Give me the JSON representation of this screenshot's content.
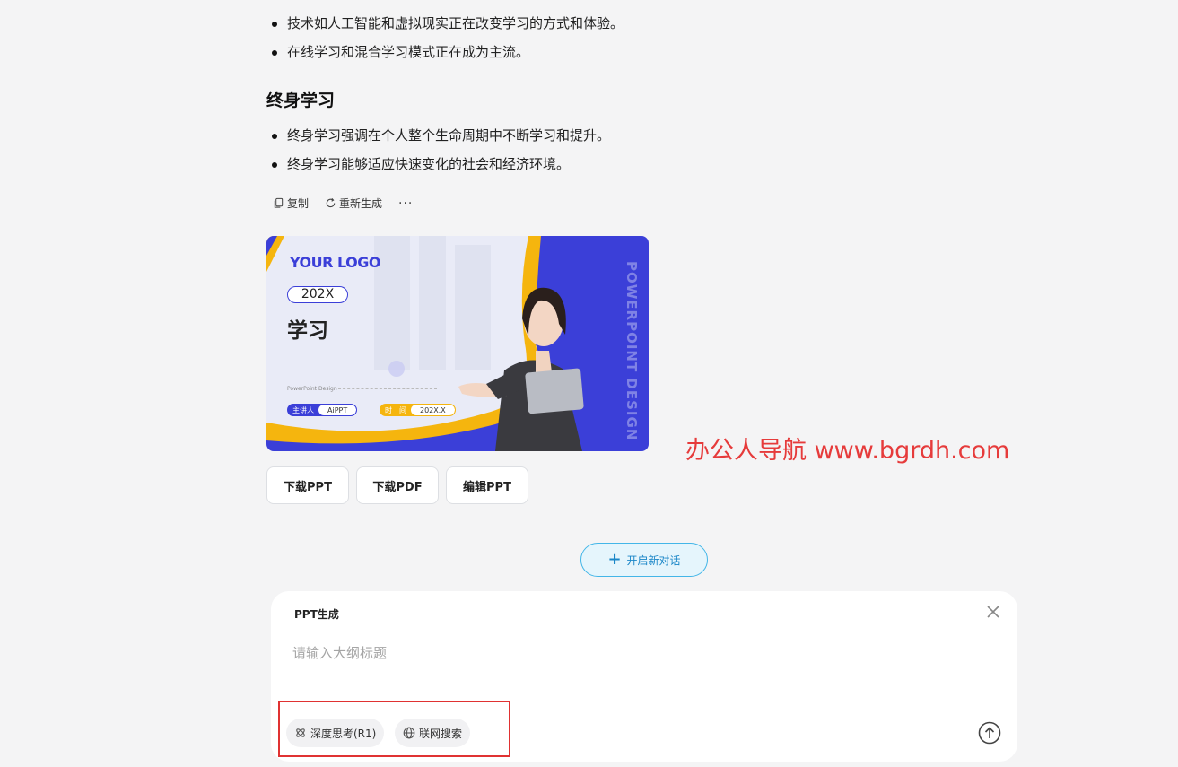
{
  "content": {
    "list_top": [
      "技术如人工智能和虚拟现实正在改变学习的方式和体验。",
      "在线学习和混合学习模式正在成为主流。"
    ],
    "section_heading": "终身学习",
    "list_bottom": [
      "终身学习强调在个人整个生命周期中不断学习和提升。",
      "终身学习能够适应快速变化的社会和经济环境。"
    ]
  },
  "actions": {
    "copy_label": "复制",
    "regenerate_label": "重新生成",
    "more_label": "···"
  },
  "slide": {
    "logo_text": "YOUR LOGO",
    "year": "202X",
    "title": "学习",
    "subtitle": "PowerPoint Design",
    "speaker_key": "主讲人",
    "speaker_value": "AiPPT",
    "time_key": "时　间",
    "time_value": "202X.X",
    "vertical_text": "POWERPOINT DESIGN",
    "colors": {
      "primary": "#3b3fd8",
      "accent": "#f5b50e"
    }
  },
  "downloads": {
    "ppt_label": "下载PPT",
    "pdf_label": "下载PDF",
    "edit_label": "编辑PPT"
  },
  "watermark": "办公人导航 www.bgrdh.com",
  "new_chat": {
    "label": "开启新对话",
    "icon": "plus-icon"
  },
  "composer": {
    "tag": "PPT生成",
    "placeholder": "请输入大纲标题",
    "value": "",
    "deep_think_label": "深度思考(R1)",
    "web_search_label": "联网搜索",
    "icons": [
      "close-icon",
      "deep-think-icon",
      "globe-icon",
      "send-arrow-icon"
    ]
  },
  "colors": {
    "background": "#f4f4f5",
    "new_chat_border": "#43b6e8",
    "highlight": "#e03232",
    "watermark": "#e63b3b"
  }
}
